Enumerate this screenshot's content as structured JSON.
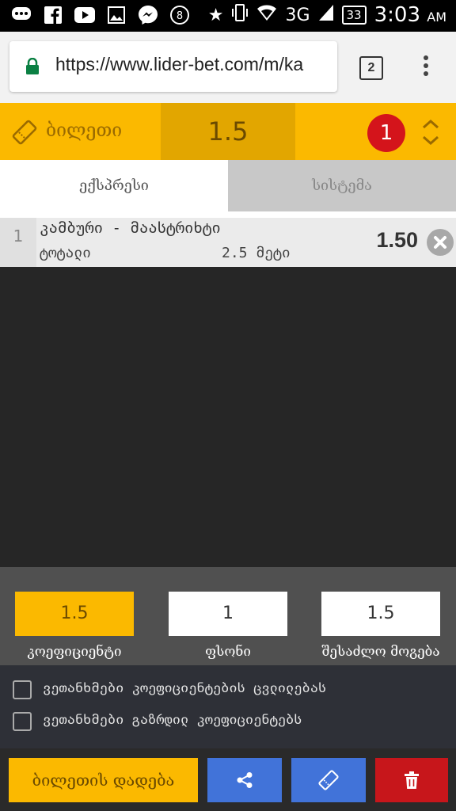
{
  "status_bar": {
    "icons": [
      "chat-dots-icon",
      "facebook-icon",
      "youtube-icon",
      "image-icon",
      "messenger-icon",
      "eight-ball-icon"
    ],
    "right_icons": [
      "star-icon",
      "vibrate-icon",
      "wifi-icon",
      "signal-icon"
    ],
    "network": "3G",
    "battery": "33",
    "time": "3:03",
    "ampm": "AM"
  },
  "browser": {
    "url": "https://www.lider-bet.com/m/ka",
    "tab_count": "2"
  },
  "ticket": {
    "title": "ბილეთი",
    "total_odds": "1.5",
    "count": "1",
    "accent": "#fbb900"
  },
  "tabs": [
    {
      "label": "ექსპრესი",
      "active": true
    },
    {
      "label": "სისტემა",
      "active": false
    }
  ],
  "bets": [
    {
      "index": "1",
      "match": "კამბური - მაასტრიხტი",
      "market": "ტოტალი",
      "line": "2.5 მეტი",
      "odd": "1.50"
    }
  ],
  "calc": {
    "coefficient": {
      "value": "1.5",
      "label": "კოეფიციენტი"
    },
    "stake": {
      "value": "1",
      "label": "ფსონი"
    },
    "possible_win": {
      "value": "1.5",
      "label": "შესაძლო მოგება"
    }
  },
  "options": [
    {
      "label": "ვეთანხმები კოეფიციენტების ცვლილებას",
      "checked": false
    },
    {
      "label": "ვეთანხმები გაზრდილ კოეფიციენტებს",
      "checked": false
    }
  ],
  "actions": {
    "place_label": "ბილეთის დადება",
    "share_icon": "share-icon",
    "ticket_icon": "ticket-icon",
    "delete_icon": "trash-icon"
  }
}
